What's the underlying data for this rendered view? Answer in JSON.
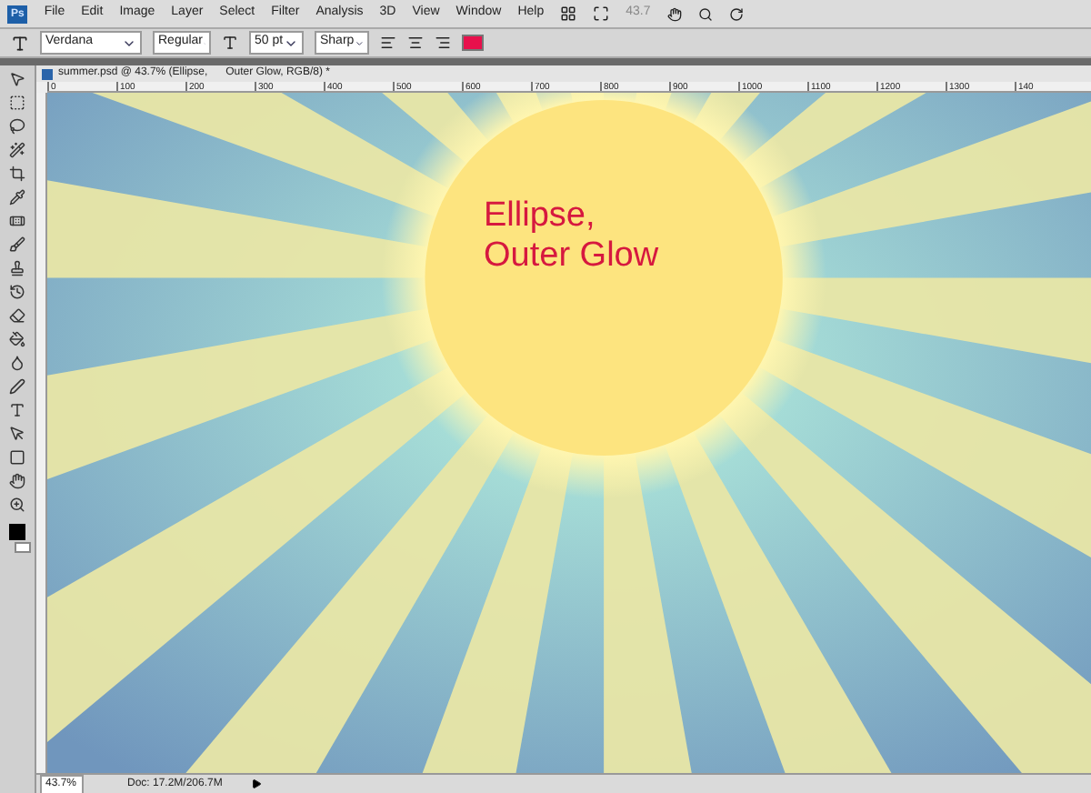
{
  "menu_bar": {
    "logo": "Ps",
    "items": [
      "File",
      "Edit",
      "Image",
      "Layer",
      "Select",
      "Filter",
      "Analysis",
      "3D",
      "View",
      "Window",
      "Help"
    ],
    "zoom": "43.7"
  },
  "options_bar": {
    "font_family": "Verdana",
    "font_style": "Regular",
    "font_size": "50 pt",
    "antialias": "Sharp"
  },
  "document": {
    "tab_title": "summer.psd @ 43.7% (Ellipse,      Outer Glow, RGB/8) *",
    "ruler_labels": [
      "0",
      "100",
      "200",
      "300",
      "400",
      "500",
      "600",
      "700",
      "800",
      "900",
      "1000",
      "1100",
      "1200",
      "1300",
      "140"
    ],
    "canvas_text": [
      "Ellipse,",
      "Outer Glow"
    ]
  },
  "status_bar": {
    "zoom": "43.7%",
    "doc_size": "Doc: 17.2M/206.7M"
  }
}
